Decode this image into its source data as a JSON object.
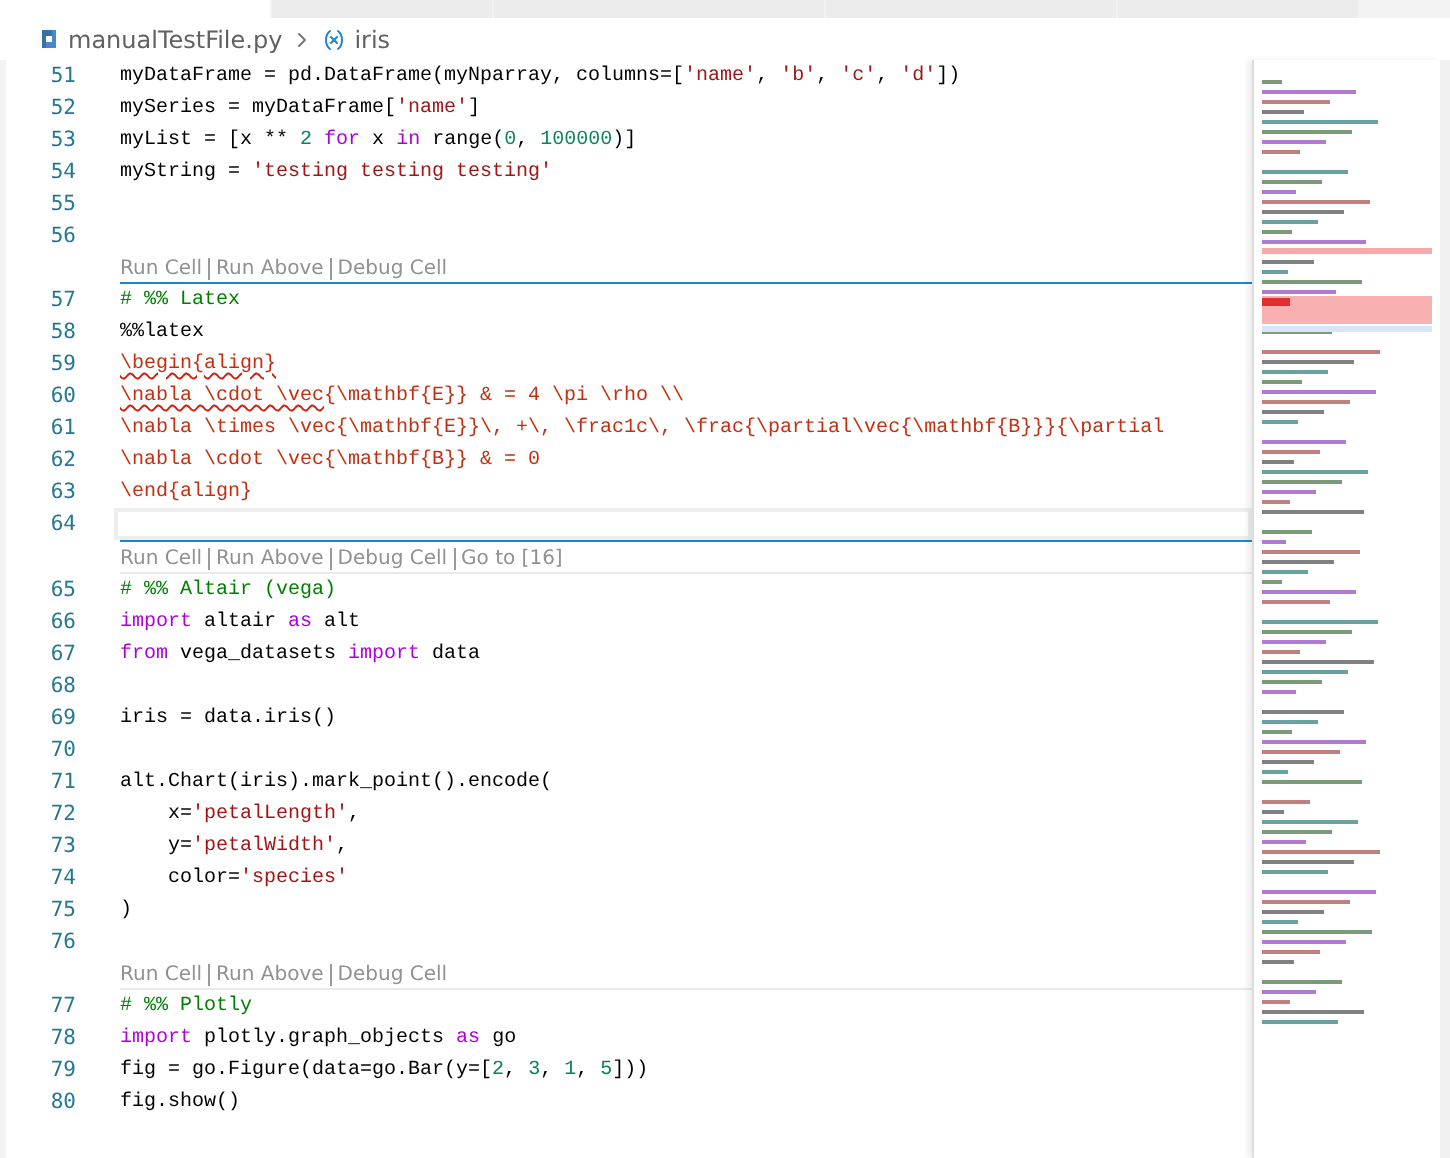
{
  "tabs": [
    {
      "selected": true
    },
    {
      "selected": false
    },
    {
      "selected": false
    },
    {
      "selected": false
    },
    {
      "selected": false
    }
  ],
  "breadcrumb": {
    "file": "manualTestFile.py",
    "symbol": "iris"
  },
  "cells": [
    {
      "lines": [
        {
          "number": "51",
          "tokens": [
            {
              "kind": "plain",
              "text": "myDataFrame = pd.DataFrame(myNparray, columns=["
            },
            {
              "kind": "string",
              "text": "'name'"
            },
            {
              "kind": "plain",
              "text": ", "
            },
            {
              "kind": "string",
              "text": "'b'"
            },
            {
              "kind": "plain",
              "text": ", "
            },
            {
              "kind": "string",
              "text": "'c'"
            },
            {
              "kind": "plain",
              "text": ", "
            },
            {
              "kind": "string",
              "text": "'d'"
            },
            {
              "kind": "plain",
              "text": "])"
            }
          ]
        },
        {
          "number": "52",
          "tokens": [
            {
              "kind": "plain",
              "text": "mySeries = myDataFrame["
            },
            {
              "kind": "string",
              "text": "'name'"
            },
            {
              "kind": "plain",
              "text": "]"
            }
          ]
        },
        {
          "number": "53",
          "tokens": [
            {
              "kind": "plain",
              "text": "myList = [x ** "
            },
            {
              "kind": "number",
              "text": "2"
            },
            {
              "kind": "keyword",
              "text": " for"
            },
            {
              "kind": "plain",
              "text": " x "
            },
            {
              "kind": "keyword",
              "text": "in"
            },
            {
              "kind": "plain",
              "text": " range("
            },
            {
              "kind": "number",
              "text": "0"
            },
            {
              "kind": "plain",
              "text": ", "
            },
            {
              "kind": "number",
              "text": "100000"
            },
            {
              "kind": "plain",
              "text": ")]"
            }
          ]
        },
        {
          "number": "54",
          "tokens": [
            {
              "kind": "plain",
              "text": "myString = "
            },
            {
              "kind": "string",
              "text": "'testing testing testing'"
            }
          ]
        },
        {
          "number": "55"
        },
        {
          "number": "56"
        }
      ]
    },
    {
      "active": true,
      "lens": [
        "Run Cell",
        "Run Above",
        "Debug Cell"
      ],
      "lines": [
        {
          "number": "57",
          "tokens": [
            {
              "kind": "comment",
              "text": "# %% Latex"
            }
          ]
        },
        {
          "number": "58",
          "tokens": [
            {
              "kind": "plain",
              "text": "%%latex"
            }
          ]
        },
        {
          "number": "59",
          "tokens": [
            {
              "kind": "latex",
              "text": "\\begin{align}",
              "squiggle": true
            }
          ]
        },
        {
          "number": "60",
          "tokens": [
            {
              "kind": "latex",
              "text": "\\nabla \\cdot \\vec",
              "squiggle": true
            },
            {
              "kind": "latex",
              "text": "{\\mathbf{E}} & = 4 \\pi \\rho \\\\"
            }
          ]
        },
        {
          "number": "61",
          "tokens": [
            {
              "kind": "latex",
              "text": "\\nabla \\times \\vec{\\mathbf{E}}\\, +\\, \\frac1c\\, \\frac{\\partial\\vec{\\mathbf{B}}}{\\partial"
            }
          ]
        },
        {
          "number": "62",
          "tokens": [
            {
              "kind": "latex",
              "text": "\\nabla \\cdot \\vec{\\mathbf{B}} & = 0"
            }
          ]
        },
        {
          "number": "63",
          "tokens": [
            {
              "kind": "latex",
              "text": "\\end{align}"
            }
          ]
        },
        {
          "number": "64",
          "current": true
        }
      ]
    },
    {
      "active": false,
      "lens": [
        "Run Cell",
        "Run Above",
        "Debug Cell",
        "Go to [16]"
      ],
      "lines": [
        {
          "number": "65",
          "tokens": [
            {
              "kind": "comment",
              "text": "# %% Altair (vega)"
            }
          ]
        },
        {
          "number": "66",
          "tokens": [
            {
              "kind": "keyword",
              "text": "import"
            },
            {
              "kind": "plain",
              "text": " altair "
            },
            {
              "kind": "keyword",
              "text": "as"
            },
            {
              "kind": "plain",
              "text": " alt"
            }
          ]
        },
        {
          "number": "67",
          "tokens": [
            {
              "kind": "keyword",
              "text": "from"
            },
            {
              "kind": "plain",
              "text": " vega_datasets "
            },
            {
              "kind": "keyword",
              "text": "import"
            },
            {
              "kind": "plain",
              "text": " data"
            }
          ]
        },
        {
          "number": "68"
        },
        {
          "number": "69",
          "tokens": [
            {
              "kind": "plain",
              "text": "iris = data.iris()"
            }
          ]
        },
        {
          "number": "70"
        },
        {
          "number": "71",
          "tokens": [
            {
              "kind": "plain",
              "text": "alt.Chart(iris).mark_point().encode("
            }
          ]
        },
        {
          "number": "72",
          "tokens": [
            {
              "kind": "plain",
              "text": "    x="
            },
            {
              "kind": "string",
              "text": "'petalLength'"
            },
            {
              "kind": "plain",
              "text": ","
            }
          ]
        },
        {
          "number": "73",
          "tokens": [
            {
              "kind": "plain",
              "text": "    y="
            },
            {
              "kind": "string",
              "text": "'petalWidth'"
            },
            {
              "kind": "plain",
              "text": ","
            }
          ]
        },
        {
          "number": "74",
          "tokens": [
            {
              "kind": "plain",
              "text": "    color="
            },
            {
              "kind": "string",
              "text": "'species'"
            }
          ]
        },
        {
          "number": "75",
          "tokens": [
            {
              "kind": "plain",
              "text": ")"
            }
          ]
        },
        {
          "number": "76"
        }
      ]
    },
    {
      "active": false,
      "lens": [
        "Run Cell",
        "Run Above",
        "Debug Cell"
      ],
      "lines": [
        {
          "number": "77",
          "tokens": [
            {
              "kind": "comment",
              "text": "# %% Plotly"
            }
          ]
        },
        {
          "number": "78",
          "tokens": [
            {
              "kind": "keyword",
              "text": "import"
            },
            {
              "kind": "plain",
              "text": " plotly.graph_objects "
            },
            {
              "kind": "keyword",
              "text": "as"
            },
            {
              "kind": "plain",
              "text": " go"
            }
          ]
        },
        {
          "number": "79",
          "tokens": [
            {
              "kind": "plain",
              "text": "fig = go.Figure(data=go.Bar(y=["
            },
            {
              "kind": "number",
              "text": "2"
            },
            {
              "kind": "plain",
              "text": ", "
            },
            {
              "kind": "number",
              "text": "3"
            },
            {
              "kind": "plain",
              "text": ", "
            },
            {
              "kind": "number",
              "text": "1"
            },
            {
              "kind": "plain",
              "text": ", "
            },
            {
              "kind": "number",
              "text": "5"
            },
            {
              "kind": "plain",
              "text": "]))"
            }
          ]
        },
        {
          "number": "80",
          "tokens": [
            {
              "kind": "plain",
              "text": "fig.show()"
            }
          ]
        }
      ]
    }
  ]
}
